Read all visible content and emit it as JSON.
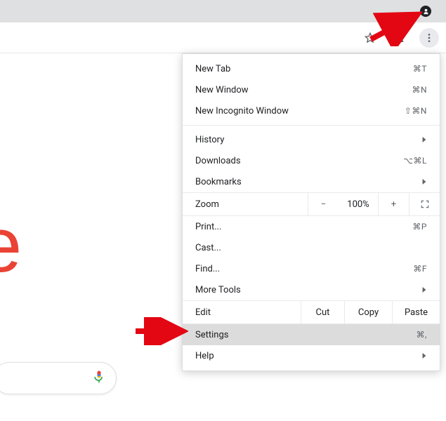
{
  "menu": {
    "new_tab": {
      "label": "New Tab",
      "accel": "⌘T"
    },
    "new_window": {
      "label": "New Window",
      "accel": "⌘N"
    },
    "new_incognito": {
      "label": "New Incognito Window",
      "accel": "⇧⌘N"
    },
    "history": {
      "label": "History"
    },
    "downloads": {
      "label": "Downloads",
      "accel": "⌥⌘L"
    },
    "bookmarks": {
      "label": "Bookmarks"
    },
    "zoom": {
      "label": "Zoom",
      "value": "100%"
    },
    "print": {
      "label": "Print...",
      "accel": "⌘P"
    },
    "cast": {
      "label": "Cast..."
    },
    "find": {
      "label": "Find...",
      "accel": "⌘F"
    },
    "more_tools": {
      "label": "More Tools"
    },
    "edit": {
      "label": "Edit",
      "cut": "Cut",
      "copy": "Copy",
      "paste": "Paste"
    },
    "settings": {
      "label": "Settings",
      "accel": "⌘,"
    },
    "help": {
      "label": "Help"
    }
  },
  "page": {
    "google_letter": "e"
  }
}
